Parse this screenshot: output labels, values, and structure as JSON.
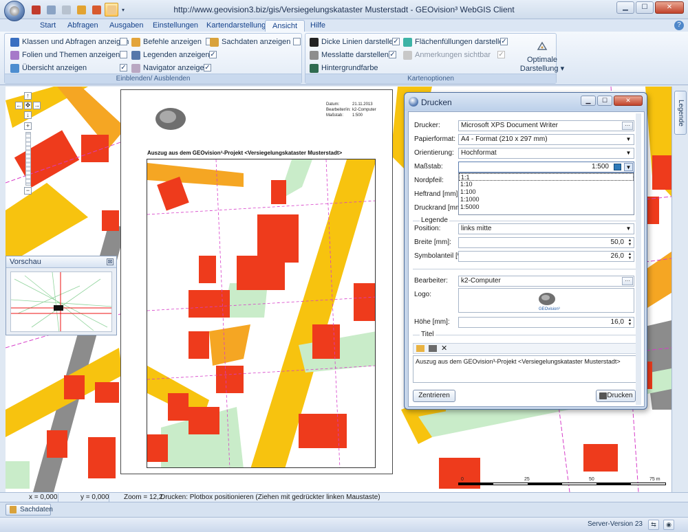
{
  "window": {
    "title": "http://www.geovision3.biz/gis/Versiegelungskataster Musterstadt - GEOvision³ WebGIS Client",
    "minimize": "▁",
    "maximize": "☐",
    "close": "✕"
  },
  "ribbon_tabs": [
    "Start",
    "Abfragen",
    "Ausgaben",
    "Einstellungen",
    "Kartendarstellung",
    "Ansicht",
    "Hilfe"
  ],
  "active_tab": "Ansicht",
  "ribbon": {
    "group1": {
      "label": "Einblenden/ Ausblenden",
      "items": [
        {
          "label": "Klassen und Abfragen anzeigen",
          "icon": "classes-icon",
          "checked": false
        },
        {
          "label": "Folien und Themen anzeigen",
          "icon": "layers-icon",
          "checked": false
        },
        {
          "label": "Übersicht anzeigen",
          "icon": "overview-icon",
          "checked": true
        },
        {
          "label": "Befehle anzeigen",
          "icon": "commands-icon",
          "checked": false
        },
        {
          "label": "Legenden anzeigen",
          "icon": "legend-icon",
          "checked": true
        },
        {
          "label": "Navigator anzeigen",
          "icon": "navigator-icon",
          "checked": true
        },
        {
          "label": "Sachdaten anzeigen",
          "icon": "attribute-data-icon",
          "checked": false
        }
      ]
    },
    "group2": {
      "label": "Kartenoptionen",
      "items": [
        {
          "label": "Dicke Linien darstellen",
          "checked": true
        },
        {
          "label": "Messlatte darstellen",
          "checked": true
        },
        {
          "label": "Hintergrundfarbe"
        },
        {
          "label": "Flächenfüllungen darstellen",
          "checked": true
        },
        {
          "label": "Anmerkungen sichtbar",
          "checked": true,
          "disabled": true
        }
      ],
      "optimal_line1": "Optimale",
      "optimal_line2": "Darstellung ▾"
    }
  },
  "legend_tab": "Legende",
  "preview": {
    "title": "Vorschau",
    "close": "⊠"
  },
  "sheet": {
    "meta_labels": [
      "Datum:",
      "Bearbeiter/in:",
      "Maßstab:"
    ],
    "meta_values": [
      "21.11.2013",
      "k2-Computer",
      "1:500"
    ],
    "logo_text": "GEOvision³",
    "title": "Auszug aus dem GEOvision³-Projekt <Versiegelungskataster Musterstadt>"
  },
  "scalebar": {
    "labels": [
      "0",
      "25",
      "50",
      "75 m"
    ]
  },
  "dialog": {
    "title": "Drucken",
    "fields": {
      "drucker": {
        "label": "Drucker:",
        "value": "Microsoft XPS Document Writer"
      },
      "papierformat": {
        "label": "Papierformat:",
        "value": "A4 - Format (210 x 297 mm)"
      },
      "orientierung": {
        "label": "Orientierung:",
        "value": "Hochformat"
      },
      "massstab": {
        "label": "Maßstab:",
        "value": "1:500"
      },
      "nordpfeil": {
        "label": "Nordpfeil:"
      },
      "heftrand": {
        "label": "Heftrand [mm]:"
      },
      "druckrand": {
        "label": "Druckrand [mm]:"
      }
    },
    "scale_options": [
      "1:1",
      "1:10",
      "1:100",
      "1:1000",
      "1:5000"
    ],
    "legende": {
      "section": "Legende",
      "position_label": "Position:",
      "position_value": "links mitte",
      "breite_label": "Breite [mm]:",
      "breite_value": "50,0",
      "symbol_label": "Symbolanteil [%]:",
      "symbol_value": "26,0"
    },
    "bearbeiter": {
      "label": "Bearbeiter:",
      "value": "k2-Computer"
    },
    "logo_label": "Logo:",
    "logo_text": "GEOvision³",
    "hoehe": {
      "label": "Höhe [mm]:",
      "value": "16,0"
    },
    "titel": {
      "section": "Titel",
      "text": "Auszug aus dem GEOvision³-Projekt <Versiegelungskataster Musterstadt>"
    },
    "buttons": {
      "zentrieren": "Zentrieren",
      "drucken": "Drucken"
    }
  },
  "status": {
    "x": "x = 0,000",
    "y": "y = 0,000",
    "zoom": "Zoom = 12,2",
    "message": "Drucken: Plotbox positionieren (Ziehen mit gedrückter linken Maustaste)"
  },
  "sachdaten_tab": "Sachdaten",
  "server_version": "Server-Version 23",
  "colors": {
    "building": "#ee3b1c",
    "road_yellow": "#f7c30f",
    "road_orange": "#f5a623",
    "green": "#c9ecc9",
    "grey": "#8c8c8c",
    "parcel_line": "#d63cc8"
  }
}
